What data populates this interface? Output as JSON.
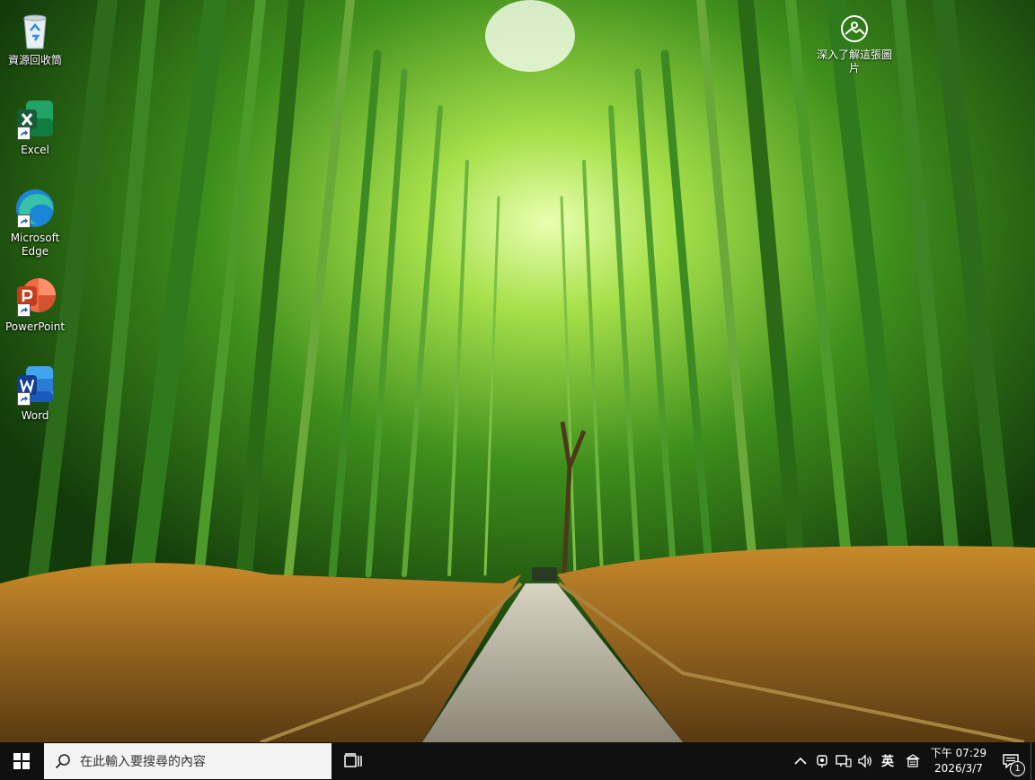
{
  "desktop": {
    "icons": [
      {
        "label": "資源回收筒",
        "icon": "recycle-bin-icon"
      },
      {
        "label": "Excel",
        "icon": "excel-icon"
      },
      {
        "label": "Microsoft Edge",
        "icon": "edge-icon"
      },
      {
        "label": "PowerPoint",
        "icon": "powerpoint-icon"
      },
      {
        "label": "Word",
        "icon": "word-icon"
      }
    ],
    "learn_more": {
      "label": "深入了解這張圖片",
      "icon": "camera-icon"
    }
  },
  "taskbar": {
    "start_icon": "windows-logo-icon",
    "search_placeholder": "在此輸入要搜尋的內容",
    "search_icon": "search-icon",
    "task_view_icon": "task-view-icon",
    "tray": {
      "ime_mode": "英",
      "clock_time": "下午 07:29",
      "clock_date": "2026/3/7",
      "notification_count": "1"
    }
  },
  "colors": {
    "taskbar_bg": "#101010",
    "search_bg": "#f3f3f3",
    "excel": "#1d7a45",
    "word": "#1c5ec9",
    "powerpoint": "#d9461f"
  }
}
